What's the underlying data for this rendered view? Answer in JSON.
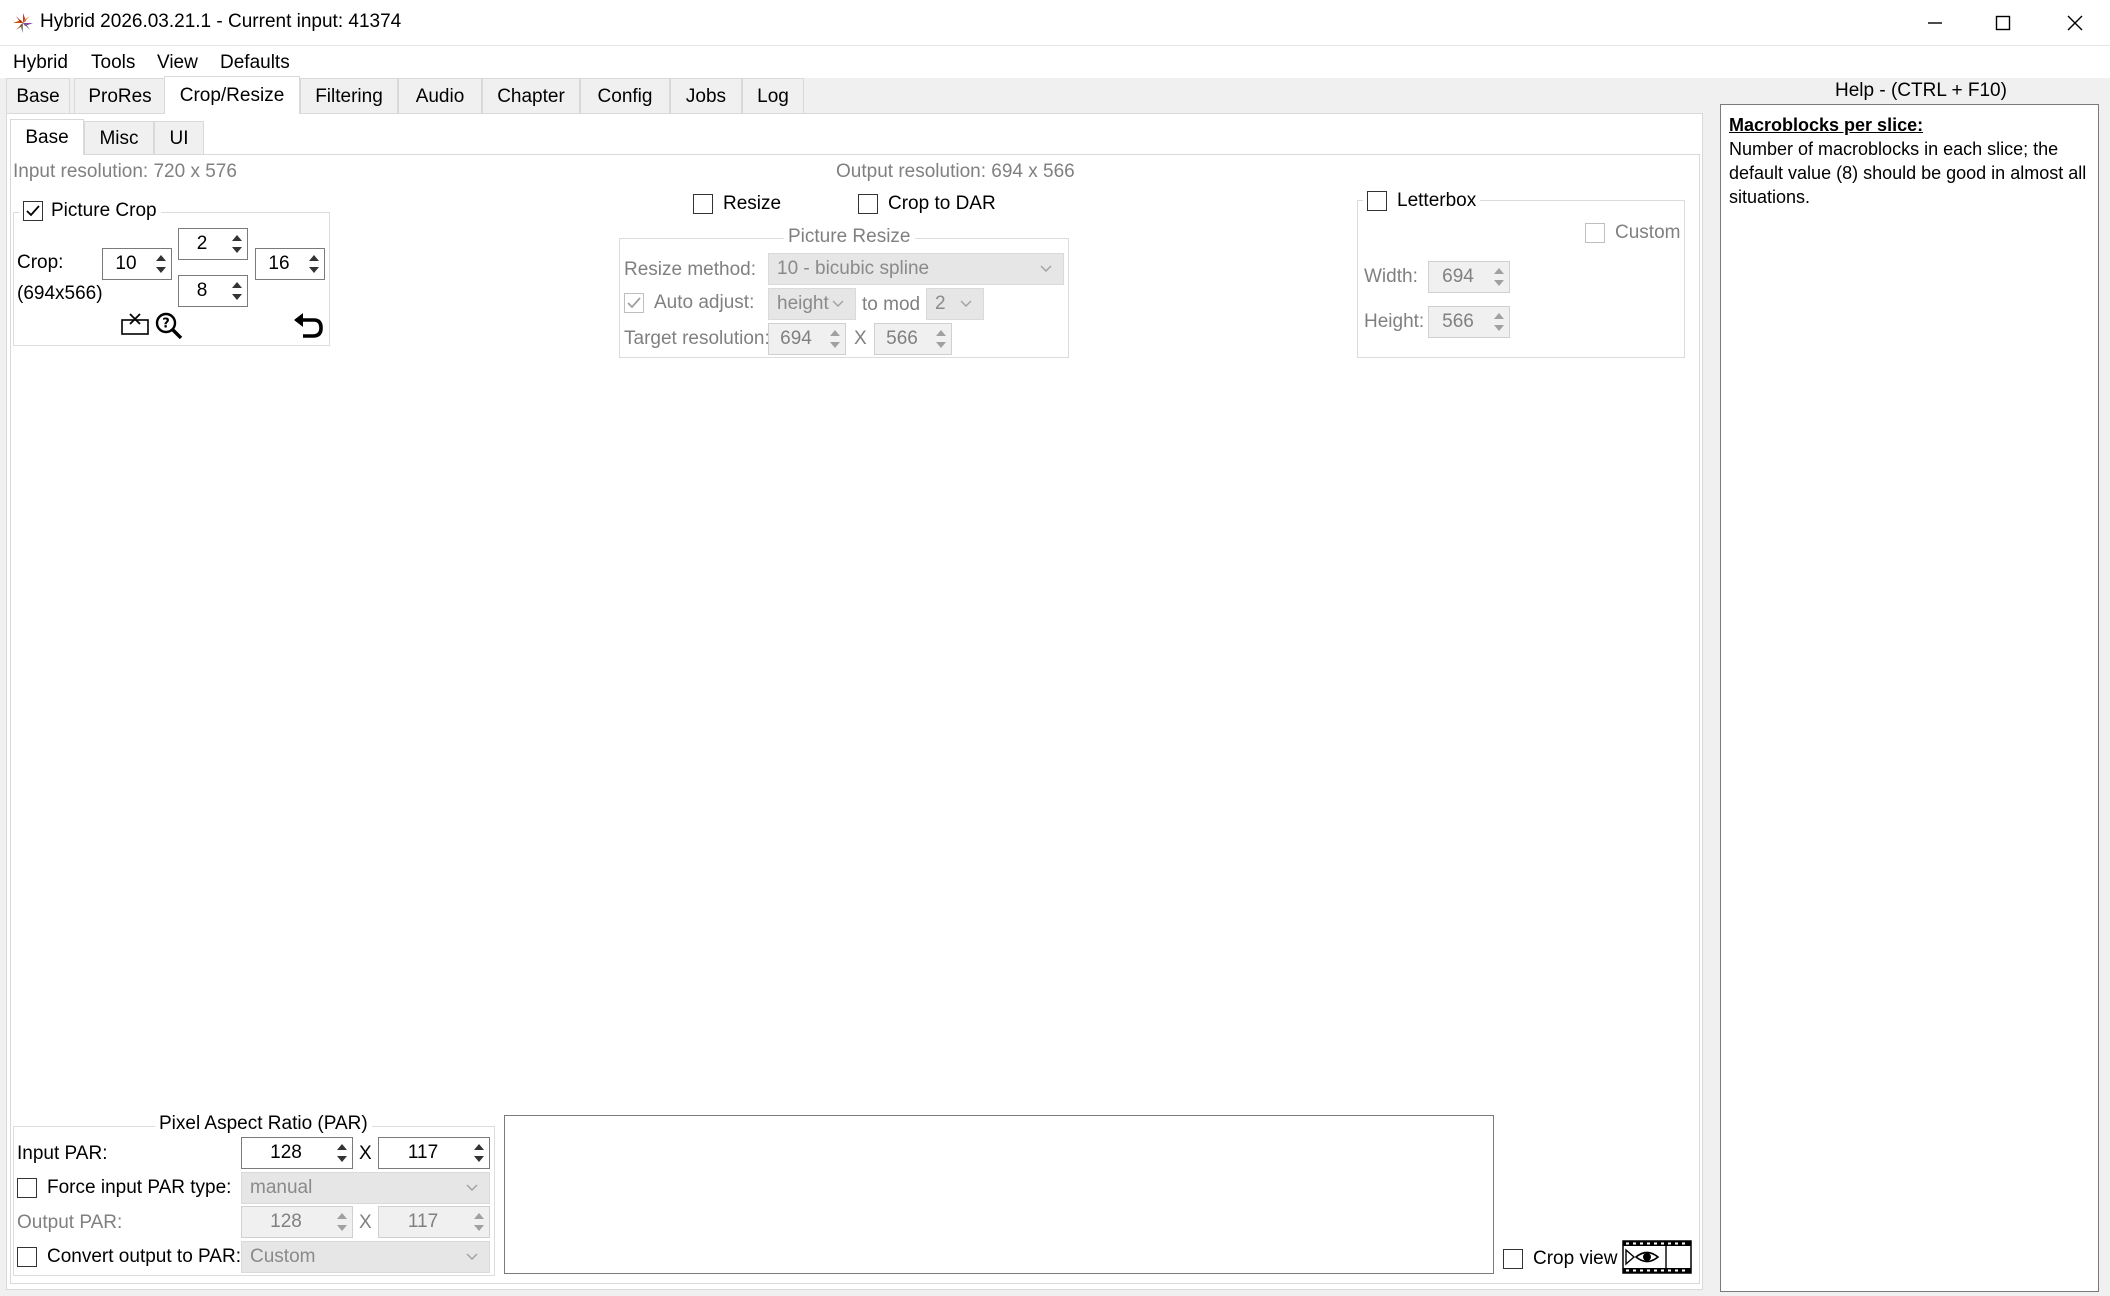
{
  "window": {
    "title": "Hybrid 2026.03.21.1 - Current input: 41374",
    "icons": [
      "minimize-icon",
      "maximize-icon",
      "close-icon"
    ]
  },
  "menu": [
    "Hybrid",
    "Tools",
    "View",
    "Defaults"
  ],
  "tabs": [
    "Base",
    "ProRes",
    "Crop/Resize",
    "Filtering",
    "Audio",
    "Chapter",
    "Config",
    "Jobs",
    "Log"
  ],
  "active_tab": "Crop/Resize",
  "subtabs": [
    "Base",
    "Misc",
    "UI"
  ],
  "active_subtab": "Base",
  "crop": {
    "input_resolution": "Input resolution: 720 x 576",
    "picture_crop_label": "Picture Crop",
    "picture_crop_checked": true,
    "crop_label": "Crop:",
    "size_label": "(694x566)",
    "top": "2",
    "left": "10",
    "right": "16",
    "bottom": "8"
  },
  "resize": {
    "output_resolution": "Output resolution: 694 x 566",
    "resize_label": "Resize",
    "crop_to_dar_label": "Crop to DAR",
    "group_title": "Picture Resize",
    "method_label": "Resize method:",
    "method_value": "10 - bicubic spline",
    "auto_adjust_label": "Auto adjust:",
    "auto_adjust_value": "height",
    "to_mod_label": "to mod",
    "to_mod_value": "2",
    "target_label": "Target resolution:",
    "target_width": "694",
    "x_sep": "X",
    "target_height": "566"
  },
  "letterbox": {
    "label": "Letterbox",
    "custom_label": "Custom",
    "width_label": "Width:",
    "width_value": "694",
    "height_label": "Height:",
    "height_value": "566"
  },
  "par": {
    "group_title": "Pixel Aspect Ratio (PAR)",
    "input_label": "Input PAR:",
    "input_w": "128",
    "input_h": "117",
    "x_sep": "X",
    "force_label": "Force input PAR type:",
    "force_value": "manual",
    "output_label": "Output PAR:",
    "output_w": "128",
    "output_h": "117",
    "convert_label": "Convert output to PAR:",
    "convert_value": "Custom"
  },
  "cropview": {
    "label": "Crop view"
  },
  "help": {
    "title": "Help - (CTRL + F10)",
    "heading": "Macroblocks per slice:",
    "body": "Number of macroblocks in each slice; the default value (8) should be good in almost all situations."
  }
}
